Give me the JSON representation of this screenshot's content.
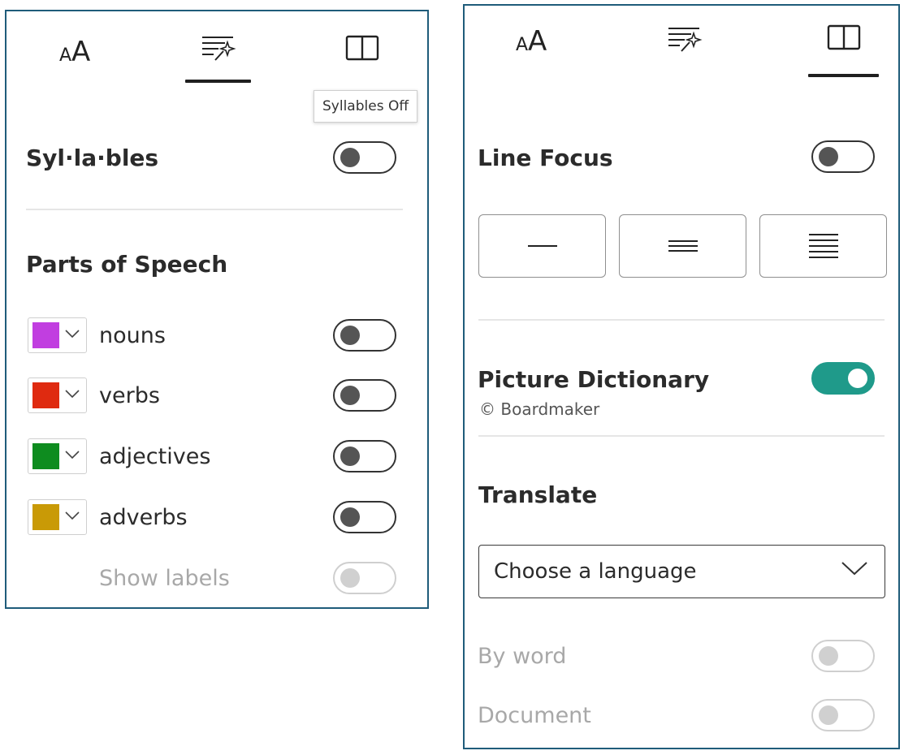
{
  "left_panel": {
    "tabs": [
      {
        "name": "text-options",
        "icon": "text-size-icon"
      },
      {
        "name": "grammar-tools",
        "icon": "grammar-sparkle-icon",
        "selected": true
      },
      {
        "name": "reading-preferences",
        "icon": "book-icon"
      }
    ],
    "tooltip": "Syllables Off",
    "syllables_label": "Syl·la·bles",
    "syllables_on": false,
    "parts_of_speech_heading": "Parts of Speech",
    "parts_of_speech": [
      {
        "label": "nouns",
        "color": "#c13ee0",
        "on": false
      },
      {
        "label": "verbs",
        "color": "#df2a10",
        "on": false
      },
      {
        "label": "adjectives",
        "color": "#0e8c1f",
        "on": false
      },
      {
        "label": "adverbs",
        "color": "#c99a06",
        "on": false
      }
    ],
    "show_labels_label": "Show labels",
    "show_labels_enabled": false
  },
  "right_panel": {
    "tabs": [
      {
        "name": "text-options",
        "icon": "text-size-icon"
      },
      {
        "name": "grammar-tools",
        "icon": "grammar-sparkle-icon"
      },
      {
        "name": "reading-preferences",
        "icon": "book-icon",
        "selected": true
      }
    ],
    "line_focus_label": "Line Focus",
    "line_focus_on": false,
    "line_focus_options": [
      "one-line",
      "three-lines",
      "five-lines"
    ],
    "picture_dictionary_label": "Picture Dictionary",
    "picture_dictionary_credit": "© Boardmaker",
    "picture_dictionary_on": true,
    "translate_heading": "Translate",
    "language_placeholder": "Choose a language",
    "by_word_label": "By word",
    "document_label": "Document",
    "translate_toggles_enabled": false
  },
  "colors": {
    "panel_border": "#1f5c7a",
    "toggle_on": "#1f9a8a",
    "disabled_text": "#a8a8a8"
  }
}
